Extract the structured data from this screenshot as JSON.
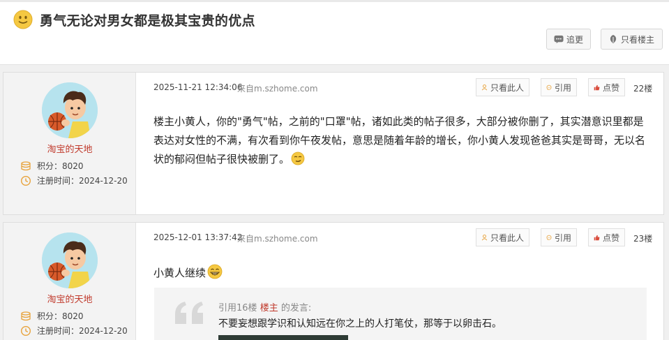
{
  "thread": {
    "title": "勇气无论对男女都是极其宝贵的优点",
    "reply_label": "追更",
    "only_op_label": "只看楼主"
  },
  "post_actions": {
    "only_this_label": "只看此人",
    "quote_label": "引用",
    "like_label": "点赞"
  },
  "posts": [
    {
      "username": "淘宝的天地",
      "points_text": "积分：8020",
      "register_text": "注册时间：2024-12-20",
      "time": "2025-11-21 12:34:06",
      "source": "来自m.szhome.com",
      "floor": "22楼",
      "content": "楼主小黄人，你的\"勇气\"帖，之前的\"口罩\"帖，诸如此类的帖子很多，大部分被你删了，其实潜意识里都是表达对女性的不满，有次看到你午夜发帖，意思是随着年龄的增长，你小黄人发现爸爸其实是哥哥，无以名状的郁闷但帖子很快被删了。"
    },
    {
      "username": "淘宝的天地",
      "points_text": "积分：8020",
      "register_text": "注册时间：2024-12-20",
      "time": "2025-12-01 13:37:42",
      "source": "来自m.szhome.com",
      "floor": "23楼",
      "content": "小黄人继续",
      "quote": {
        "prefix": "引用16楼",
        "author": "楼主",
        "suffix": "的发言:",
        "text": "不要妄想跟学识和认知远在你之上的人打笔仗，那等于以卵击石。"
      }
    }
  ],
  "colors": {
    "accent_red": "#c0392b",
    "sidebar_bg": "#f3f3f3",
    "icon_orange": "#e8a33c"
  },
  "icons": [
    "smile-emoji-icon",
    "chat-bubble-icon",
    "leaf-icon",
    "user-icon",
    "quote-icon",
    "thumbs-up-icon",
    "coins-icon",
    "clock-icon",
    "smirk-emoji-icon",
    "grin-emoji-icon",
    "quote-mark-icon"
  ]
}
